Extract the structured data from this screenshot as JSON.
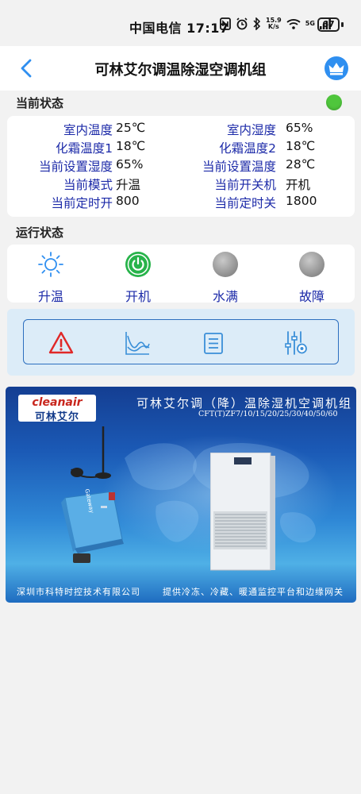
{
  "status_bar": {
    "carrier_time": "中国电信 17:17",
    "net_speed_top": "15.9",
    "net_speed_bottom": "K/s",
    "signal_label": "5G",
    "battery": "67"
  },
  "header": {
    "title": "可林艾尔调温除湿空调机组"
  },
  "current_status": {
    "section_title": "当前状态",
    "indicator_color": "#4fc63c",
    "rows": [
      {
        "l_label": "室内温度",
        "l_value": "25℃",
        "r_label": "室内湿度",
        "r_value": "65%"
      },
      {
        "l_label": "化霜温度1",
        "l_value": "18℃",
        "r_label": "化霜温度2",
        "r_value": "18℃"
      },
      {
        "l_label": "当前设置湿度",
        "l_value": "65%",
        "r_label": "当前设置温度",
        "r_value": "28℃"
      },
      {
        "l_label": "当前模式",
        "l_value": "升温",
        "r_label": "当前开关机",
        "r_value": "开机"
      },
      {
        "l_label": "当前定时开",
        "l_value": "800",
        "r_label": "当前定时关",
        "r_value": "1800"
      }
    ]
  },
  "run_status": {
    "section_title": "运行状态",
    "items": [
      {
        "label": "升温",
        "icon": "sun-icon",
        "color": "#2f8ff0"
      },
      {
        "label": "开机",
        "icon": "power-icon",
        "color": "#27b34a"
      },
      {
        "label": "水满",
        "icon": "gray-dot-icon",
        "color": "#9a9a9a"
      },
      {
        "label": "故障",
        "icon": "gray-dot-icon",
        "color": "#9a9a9a"
      }
    ]
  },
  "toolbar": {
    "items": [
      {
        "icon": "alarm-warning-icon",
        "color": "#e02828"
      },
      {
        "icon": "chart-curve-icon",
        "color": "#3a8fd8"
      },
      {
        "icon": "list-icon",
        "color": "#3a8fd8"
      },
      {
        "icon": "settings-sliders-icon",
        "color": "#3a8fd8"
      }
    ]
  },
  "banner": {
    "logo_en": "cleanair",
    "logo_cn": "可林艾尔",
    "title": "可林艾尔调（降）温除湿机空调机组",
    "model": "CFT(T)ZF7/10/15/20/25/30/40/50/60",
    "bottom_left": "深圳市科特时控技术有限公司",
    "bottom_right": "提供冷冻、冷藏、暖通监控平台和边缘网关",
    "gateway_label": "Gateway"
  }
}
